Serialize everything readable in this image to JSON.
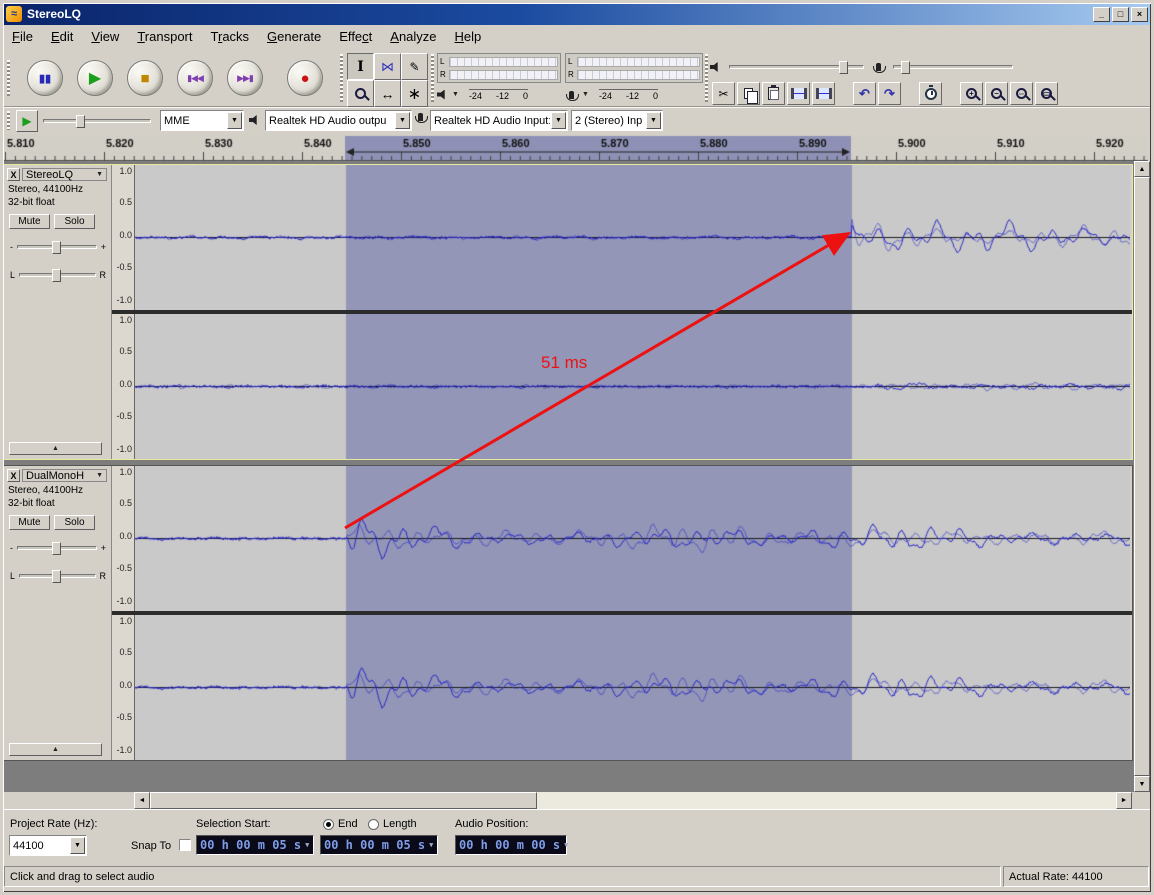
{
  "window": {
    "title": "StereoLQ",
    "minimize": "_",
    "maximize": "□",
    "close": "×"
  },
  "icons": {
    "app": "≈",
    "pause": "▮▮",
    "play": "▶",
    "stop": "■",
    "rewind": "▮◀◀",
    "forward": "▶▶▮",
    "record": "●",
    "selection_tool": "I",
    "envelope_tool": "⋈",
    "draw_tool": "✎",
    "timeshift_tool": "↔",
    "multi_tool": "∗",
    "cut": "✂",
    "undo": "↶",
    "redo": "↷",
    "zoom_in": "+",
    "zoom_out": "−",
    "zoom_sel": "⇔",
    "zoom_proj": "▭",
    "dropdown": "▼",
    "up": "▲",
    "down": "▼",
    "left": "◄",
    "right": "►",
    "collapse": "▲"
  },
  "menu": {
    "items": [
      {
        "pre": "",
        "accel": "F",
        "post": "ile"
      },
      {
        "pre": "",
        "accel": "E",
        "post": "dit"
      },
      {
        "pre": "",
        "accel": "V",
        "post": "iew"
      },
      {
        "pre": "",
        "accel": "T",
        "post": "ransport"
      },
      {
        "pre": "T",
        "accel": "r",
        "post": "acks"
      },
      {
        "pre": "",
        "accel": "G",
        "post": "enerate"
      },
      {
        "pre": "Effe",
        "accel": "c",
        "post": "t"
      },
      {
        "pre": "",
        "accel": "A",
        "post": "nalyze"
      },
      {
        "pre": "",
        "accel": "H",
        "post": "elp"
      }
    ]
  },
  "device_bar": {
    "host": "MME",
    "output_device": "Realtek HD Audio outpu",
    "input_device": "Realtek HD Audio Input:",
    "input_channels": "2 (Stereo) Inp"
  },
  "meter": {
    "left": "L",
    "right": "R",
    "scale": [
      "-24",
      "-12",
      "0"
    ]
  },
  "ruler": {
    "ticks": [
      "5.810",
      "5.820",
      "5.830",
      "5.840",
      "5.850",
      "5.860",
      "5.870",
      "5.880",
      "5.890",
      "5.900",
      "5.910",
      "5.920"
    ]
  },
  "amp_scale": [
    "1.0",
    "0.5",
    "0.0",
    "-0.5",
    "-1.0"
  ],
  "tracks": [
    {
      "name": "StereoLQ",
      "close": "X",
      "info1": "Stereo, 44100Hz",
      "info2": "32-bit float",
      "mute": "Mute",
      "solo": "Solo"
    },
    {
      "name": "DualMonoH",
      "close": "X",
      "info1": "Stereo, 44100Hz",
      "info2": "32-bit float",
      "mute": "Mute",
      "solo": "Solo"
    }
  ],
  "slider_labels": {
    "minus": "-",
    "plus": "+",
    "left": "L",
    "right": "R"
  },
  "annotation": {
    "label": "51 ms"
  },
  "selection_bar": {
    "project_rate_label": "Project Rate (Hz):",
    "project_rate_value": "44100",
    "snap_label": "Snap To",
    "selection_start_label": "Selection Start:",
    "radio_end": "End",
    "radio_length": "Length",
    "audio_position_label": "Audio Position:",
    "selection_start_value": "00 h 00 m 05 s",
    "selection_end_value": "00 h 00 m 05 s",
    "audio_position_value": "00 h 00 m 00 s"
  },
  "status_bar": {
    "message": "Click and drag to select audio",
    "actual_rate": "Actual Rate: 44100"
  },
  "colors": {
    "wave": "#2a2ac8",
    "selection_bg": "#9396b6",
    "unselected_bg": "#c9c9c9",
    "ruler_selection": "#8e91b5",
    "arrow": "#ee1111"
  },
  "waveforms": {
    "selection": {
      "start": 211,
      "end": 717
    },
    "ruler_band": {
      "start": 342,
      "end": 848
    },
    "channels": [
      {
        "id": "wave-0-0",
        "onset": 0.7206,
        "pre_amp": 0.018,
        "post_amp": 0.2,
        "burst": 1.2,
        "seed": 7
      },
      {
        "id": "wave-0-1",
        "onset": 0.7306,
        "pre_amp": 0.014,
        "post_amp": 0.05,
        "burst": 0.4,
        "seed": 19
      },
      {
        "id": "wave-1-0",
        "onset": 0.2121,
        "pre_amp": 0.014,
        "post_amp": 0.2,
        "burst": 0.9,
        "seed": 33
      },
      {
        "id": "wave-1-1",
        "onset": 0.2121,
        "pre_amp": 0.014,
        "post_amp": 0.2,
        "burst": 0.9,
        "seed": 33
      }
    ]
  }
}
